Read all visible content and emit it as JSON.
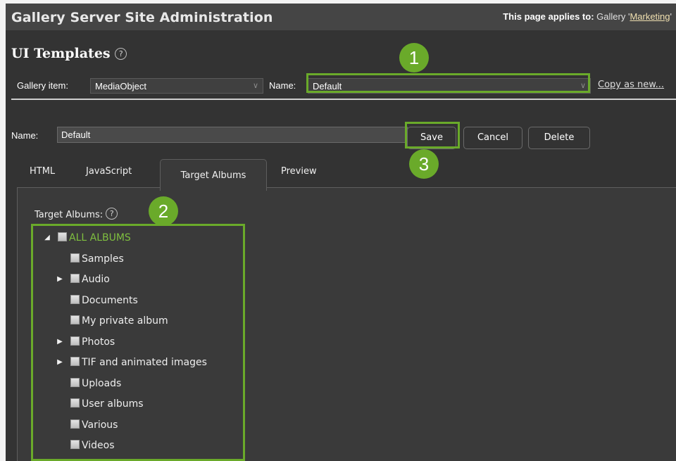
{
  "header": {
    "site_title": "Gallery Server Site Administration",
    "applies_prefix": "This page applies to:",
    "applies_middle": "Gallery '",
    "gallery_name": "Marketing",
    "applies_suffix": "'"
  },
  "page": {
    "title": "UI Templates",
    "help_glyph": "?"
  },
  "selector": {
    "gallery_item_label": "Gallery item:",
    "gallery_item_value": "MediaObject",
    "name_label": "Name:",
    "name_value": "Default",
    "copy_as_new": "Copy as new..."
  },
  "editor": {
    "name_label": "Name:",
    "name_value": "Default",
    "buttons": {
      "save": "Save",
      "cancel": "Cancel",
      "delete": "Delete"
    }
  },
  "tabs": [
    "HTML",
    "JavaScript",
    "Target Albums",
    "Preview"
  ],
  "active_tab": "Target Albums",
  "target_albums": {
    "label": "Target Albums:",
    "root": "ALL ALBUMS",
    "items": [
      {
        "label": "Samples",
        "expandable": false
      },
      {
        "label": "Audio",
        "expandable": true
      },
      {
        "label": "Documents",
        "expandable": false
      },
      {
        "label": "My private album",
        "expandable": false
      },
      {
        "label": "Photos",
        "expandable": true
      },
      {
        "label": "TIF and animated images",
        "expandable": true
      },
      {
        "label": "Uploads",
        "expandable": false
      },
      {
        "label": "User albums",
        "expandable": false
      },
      {
        "label": "Various",
        "expandable": false
      },
      {
        "label": "Videos",
        "expandable": false
      }
    ]
  },
  "callouts": [
    "1",
    "2",
    "3"
  ],
  "colors": {
    "accent_green": "#6aaa2a",
    "root_album_text": "#7fbf3f",
    "background": "#333333",
    "header": "#454545"
  }
}
